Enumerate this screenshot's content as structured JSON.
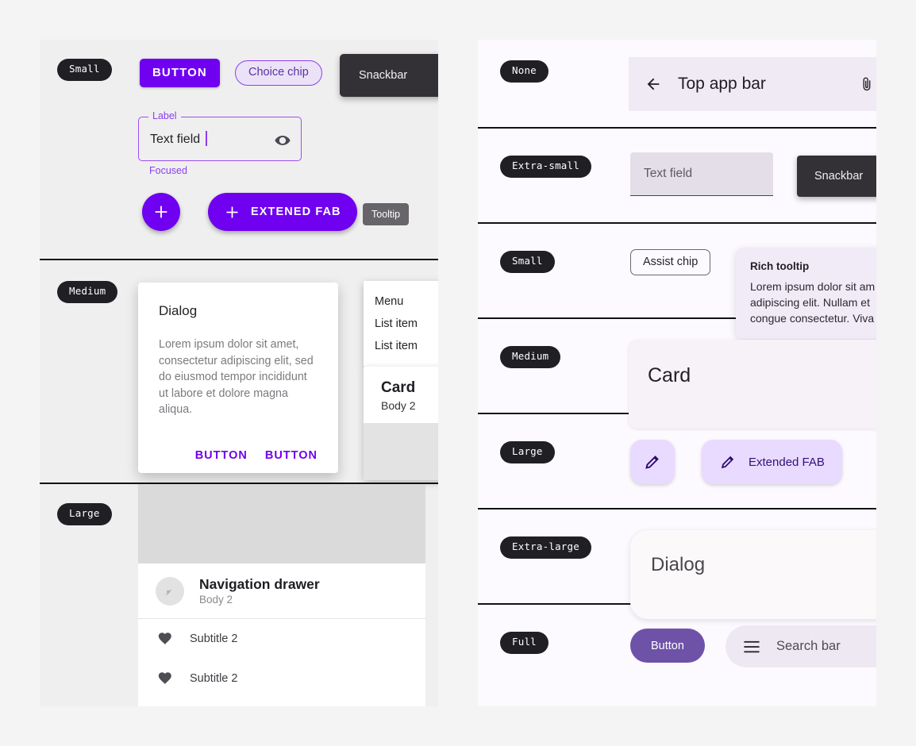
{
  "left_panel": {
    "rows": [
      {
        "badge": "Small"
      },
      {
        "badge": "Medium"
      },
      {
        "badge": "Large"
      }
    ],
    "button_label": "BUTTON",
    "choice_chip_label": "Choice chip",
    "snackbar_label": "Snackbar",
    "text_field": {
      "label": "Label",
      "value": "Text field",
      "helper": "Focused",
      "trailing_icon": "eye-icon"
    },
    "fab": {
      "icon": "plus-icon"
    },
    "extended_fab": {
      "icon": "plus-icon",
      "label": "EXTENED FAB"
    },
    "tooltip_label": "Tooltip",
    "dialog": {
      "title": "Dialog",
      "body": "Lorem ipsum dolor sit amet, consectetur adipiscing elit, sed do eiusmod tempor incididunt ut labore et dolore magna aliqua.",
      "action_1": "BUTTON",
      "action_2": "BUTTON"
    },
    "menu": {
      "title": "Menu",
      "item_1": "List item",
      "item_2": "List item"
    },
    "card": {
      "title": "Card",
      "body": "Body 2"
    },
    "nav_drawer": {
      "account_name": "Navigation drawer",
      "account_sub": "Body 2",
      "item_1": "Subtitle 2",
      "item_2": "Subtitle 2",
      "avatar_icon": "account-icon",
      "item_icon": "heart-icon"
    }
  },
  "right_panel": {
    "badges": {
      "none": "None",
      "extra_small": "Extra-small",
      "small": "Small",
      "medium": "Medium",
      "large": "Large",
      "extra_large": "Extra-large",
      "full": "Full"
    },
    "top_app_bar": {
      "title": "Top app bar",
      "back_icon": "arrow-left-icon",
      "action_icon": "attachment-icon"
    },
    "text_field_placeholder": "Text field",
    "snackbar_label": "Snackbar",
    "assist_chip_label": "Assist chip",
    "rich_tooltip": {
      "title": "Rich tooltip",
      "body": "Lorem ipsum dolor sit am\nadipiscing elit. Nullam et\ncongue consectetur. Viva"
    },
    "card_title": "Card",
    "fab": {
      "icon": "pencil-icon"
    },
    "extended_fab": {
      "icon": "pencil-icon",
      "label": "Extended FAB"
    },
    "dialog_title": "Dialog",
    "button_label": "Button",
    "search_bar": {
      "placeholder": "Search bar",
      "icon": "menu-icon"
    }
  },
  "colors": {
    "page_bg": "#f4f4f4",
    "left_panel_bg": "#efefef",
    "right_panel_bg": "#fdfaff",
    "primary_violet": "#6f00f0",
    "accent_purple": "#8b3ef0",
    "badge_bg": "#201f24",
    "snackbar_bg": "#333135",
    "fab_container": "#e9daff",
    "right_button": "#6e52a8"
  }
}
